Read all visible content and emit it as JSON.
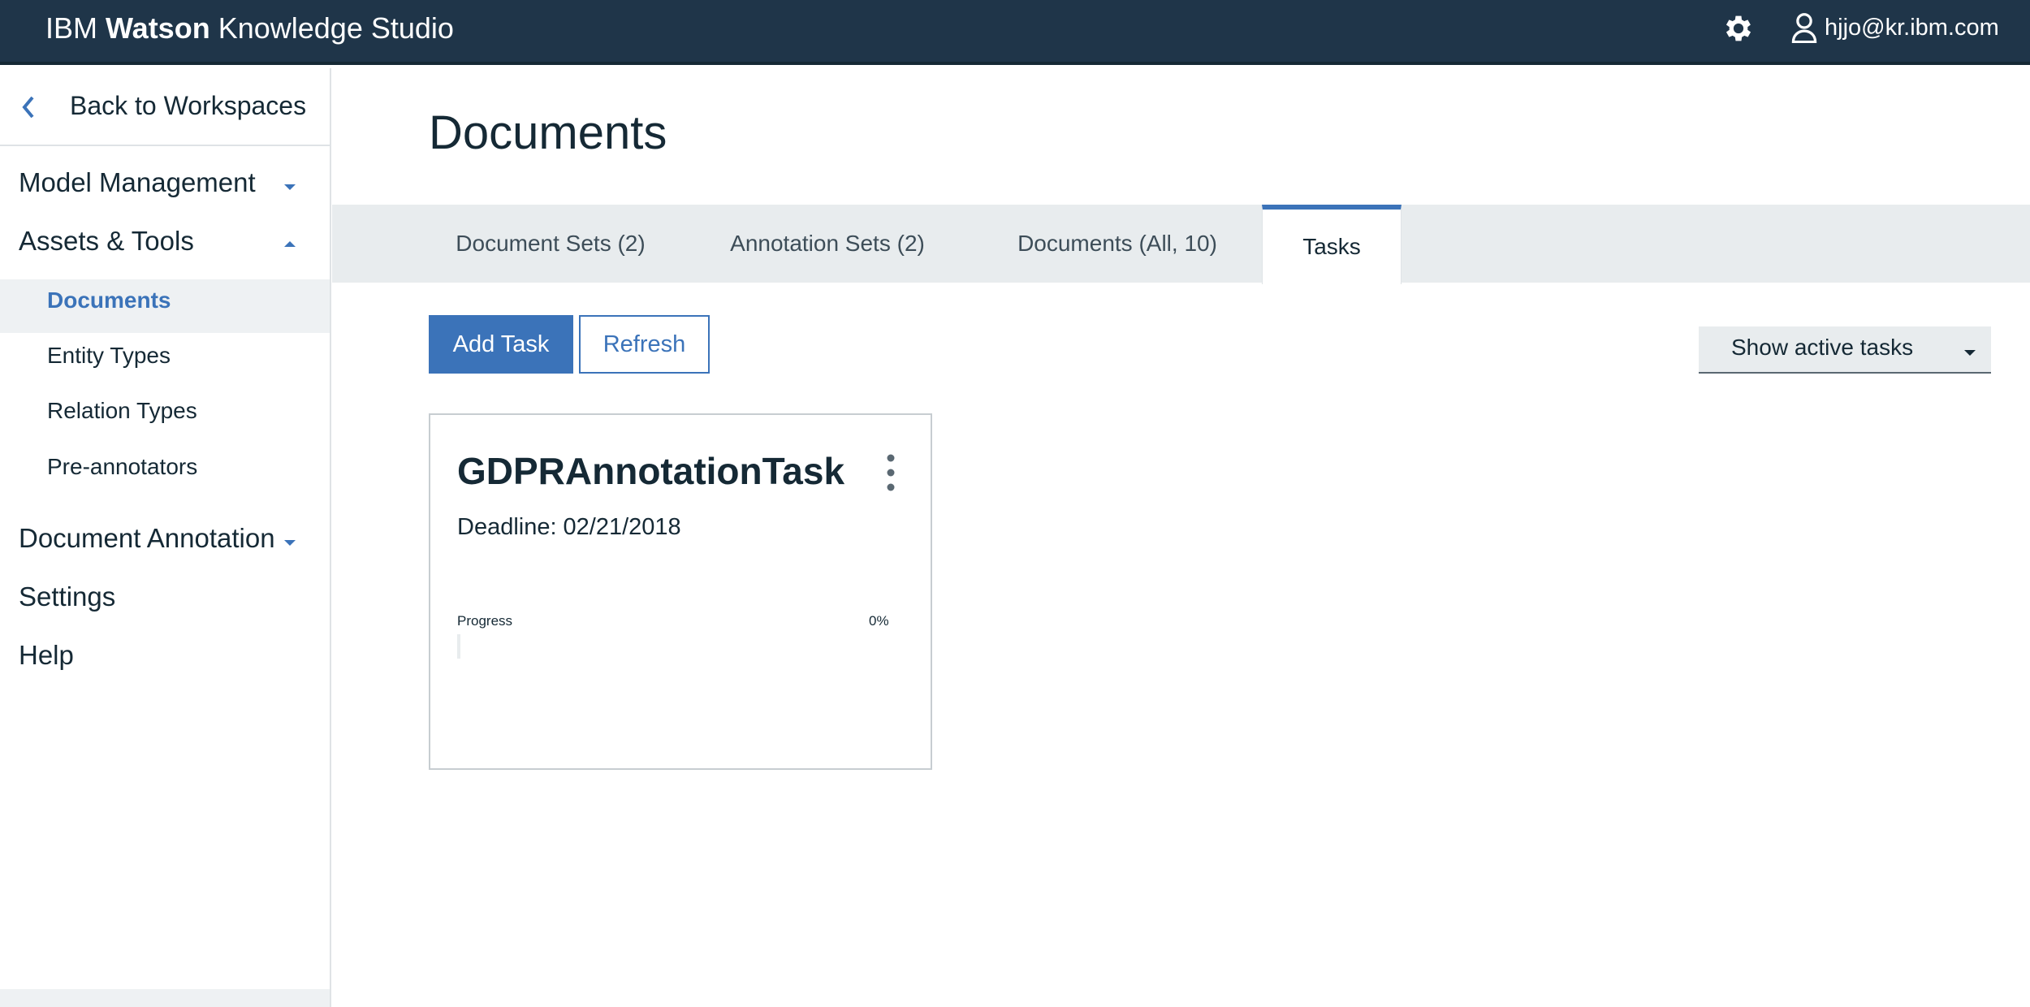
{
  "header": {
    "brand_prefix": "IBM",
    "brand_bold": "Watson",
    "brand_suffix": "Knowledge Studio",
    "settings_icon": "gear-icon",
    "user_icon": "user-icon",
    "user_email": "hjjo@kr.ibm.com",
    "bg_color": "#1f3549"
  },
  "sidebar": {
    "back_label": "Back to Workspaces",
    "sections": [
      {
        "label": "Model Management",
        "state": "collapsed"
      },
      {
        "label": "Assets & Tools",
        "state": "expanded"
      },
      {
        "label": "Document Annotation",
        "state": "collapsed"
      },
      {
        "label": "Settings"
      },
      {
        "label": "Help"
      }
    ],
    "asset_items": [
      {
        "label": "Documents",
        "active": true
      },
      {
        "label": "Entity Types"
      },
      {
        "label": "Relation Types"
      },
      {
        "label": "Pre-annotators"
      }
    ]
  },
  "main": {
    "title": "Documents",
    "tabs": [
      {
        "label": "Document Sets (2)"
      },
      {
        "label": "Annotation Sets (2)"
      },
      {
        "label": "Documents (All, 10)"
      },
      {
        "label": "Tasks",
        "active": true
      }
    ],
    "add_task_label": "Add Task",
    "refresh_label": "Refresh",
    "filter_selected": "Show active tasks",
    "accent_color": "#3b73b9"
  },
  "tasks": [
    {
      "name": "GDPRAnnotationTask",
      "deadline_label": "Deadline:",
      "deadline": "02/21/2018",
      "progress_label": "Progress",
      "progress_text": "0%",
      "progress": 0
    }
  ]
}
